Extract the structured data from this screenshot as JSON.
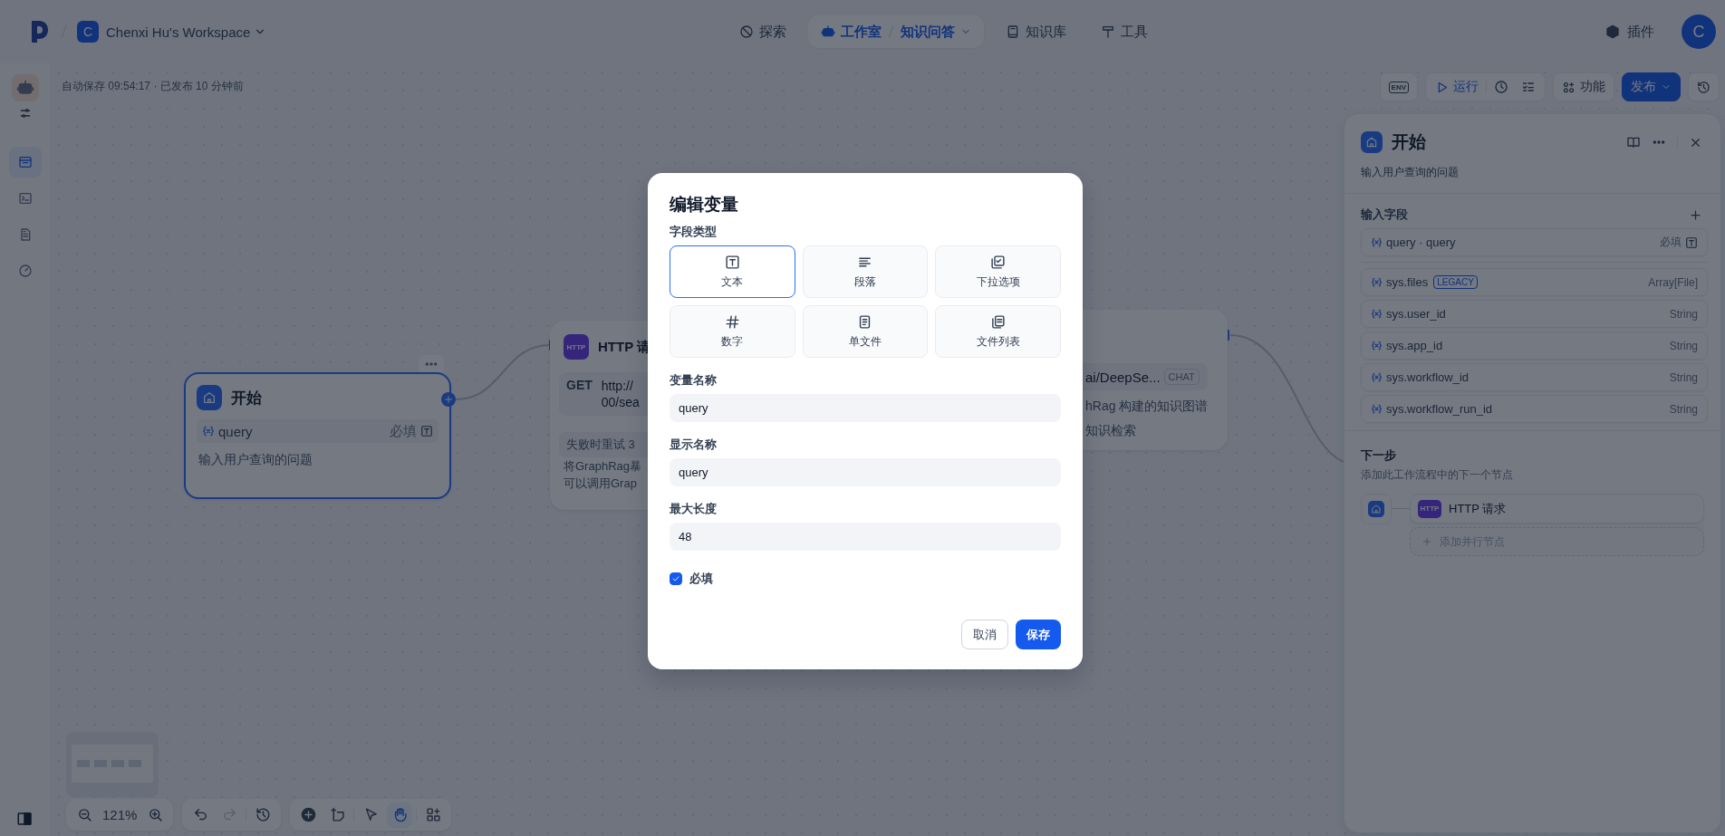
{
  "header": {
    "workspace_initial": "C",
    "workspace": "Chenxi Hu's Workspace",
    "nav": [
      {
        "kind": "explore",
        "label": "探索",
        "selected": false
      },
      {
        "kind": "studio",
        "label": "工作室",
        "app": "知识问答",
        "selected": true
      },
      {
        "kind": "knowledge",
        "label": "知识库",
        "selected": false
      },
      {
        "kind": "tools",
        "label": "工具",
        "selected": false
      }
    ],
    "plugins": "插件",
    "avatar": "C"
  },
  "sidebar": {
    "items": [
      {
        "kind": "workflow",
        "selected": true
      },
      {
        "kind": "terminal",
        "selected": false
      },
      {
        "kind": "logs",
        "selected": false
      },
      {
        "kind": "monitor",
        "selected": false
      }
    ]
  },
  "toolbar": {
    "autosave": "自动保存 09:54:17 · 已发布 10 分钟前",
    "env": "ENV",
    "run": "运行",
    "features": "功能",
    "publish": "发布"
  },
  "canvas": {
    "start": {
      "title": "开始",
      "selected": true,
      "variable": "query",
      "required": "必填",
      "description": "输入用户查询的问题"
    },
    "http": {
      "badge": "HTTP",
      "title": "HTTP 请",
      "method": "GET",
      "url": [
        "http://",
        "00/sea"
      ],
      "retry": "失败时重试 3",
      "description": [
        "将GraphRag暴",
        "可以调用Grap"
      ]
    },
    "llm": {
      "model": "ai/DeepSe...",
      "badge": "CHAT",
      "description": [
        "hRag 构建的知识图谱",
        "知识检索"
      ]
    },
    "zoom": "121%",
    "history": [
      {
        "kind": "undo",
        "disabled": false
      },
      {
        "kind": "redo",
        "disabled": true
      }
    ],
    "tools": [
      {
        "kind": "add",
        "selected": false
      },
      {
        "kind": "note",
        "selected": false
      },
      {
        "kind": "pointer",
        "selected": false
      },
      {
        "kind": "hand",
        "selected": true
      },
      {
        "kind": "organize",
        "selected": false
      }
    ]
  },
  "panel": {
    "title": "开始",
    "description": "输入用户查询的问题",
    "section": "输入字段",
    "fields": [
      {
        "name": "query · query",
        "required": "必填"
      }
    ],
    "system": [
      {
        "name": "sys.files",
        "badge": "LEGACY",
        "type": "Array[File]"
      },
      {
        "name": "sys.user_id",
        "type": "String"
      },
      {
        "name": "sys.app_id",
        "type": "String"
      },
      {
        "name": "sys.workflow_id",
        "type": "String"
      },
      {
        "name": "sys.workflow_run_id",
        "type": "String"
      }
    ],
    "next": {
      "title": "下一步",
      "subtitle": "添加此工作流程中的下一个节点",
      "badge": "HTTP",
      "node": "HTTP 请求",
      "add": "添加并行节点"
    }
  },
  "dialog": {
    "title": "编辑变量",
    "type_label": "字段类型",
    "types": [
      {
        "kind": "text",
        "label": "文本",
        "selected": true
      },
      {
        "kind": "paragraph",
        "label": "段落",
        "selected": false
      },
      {
        "kind": "select",
        "label": "下拉选项",
        "selected": false
      },
      {
        "kind": "number",
        "label": "数字",
        "selected": false
      },
      {
        "kind": "file",
        "label": "单文件",
        "selected": false
      },
      {
        "kind": "files",
        "label": "文件列表",
        "selected": false
      }
    ],
    "fields": [
      {
        "label": "变量名称",
        "value": "query"
      },
      {
        "label": "显示名称",
        "value": "query"
      },
      {
        "label": "最大长度",
        "value": "48"
      }
    ],
    "required": {
      "label": "必填",
      "checked": true
    },
    "cancel": "取消",
    "save": "保存"
  }
}
